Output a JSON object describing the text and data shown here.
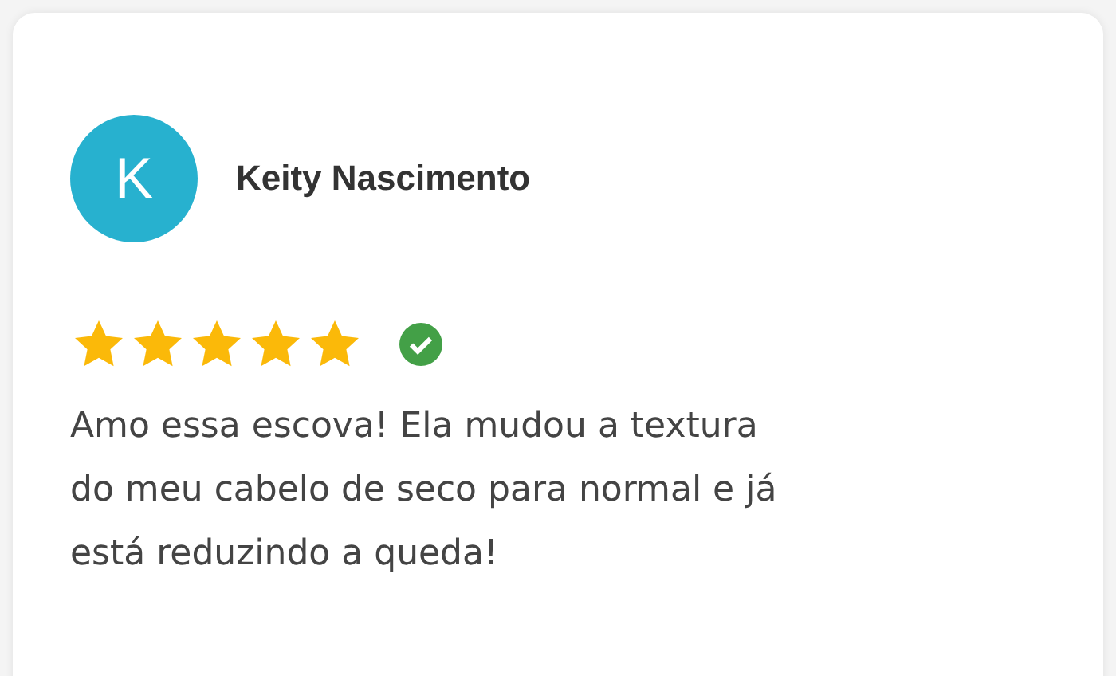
{
  "review": {
    "avatar_letter": "K",
    "author": "Keity Nascimento",
    "stars": 5,
    "verified": true,
    "text": "Amo essa escova! Ela mudou a textura do meu cabelo de seco para normal e já está reduzindo a queda!"
  }
}
